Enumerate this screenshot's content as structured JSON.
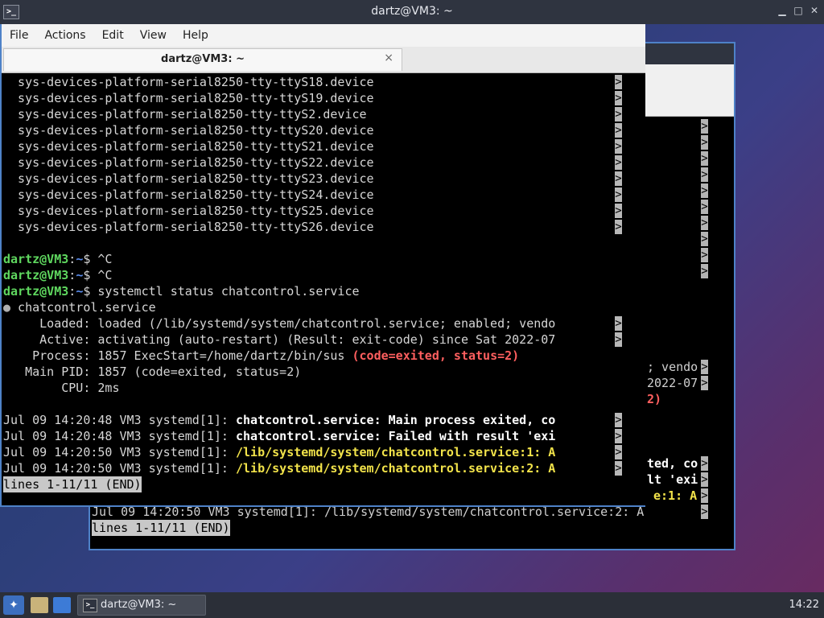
{
  "window": {
    "title": "dartz@VM3: ~"
  },
  "menu": [
    "File",
    "Actions",
    "Edit",
    "View",
    "Help"
  ],
  "tab": {
    "label": "dartz@VM3: ~",
    "close": "×"
  },
  "terminal": {
    "device_lines": [
      "  sys-devices-platform-serial8250-tty-ttyS18.device",
      "  sys-devices-platform-serial8250-tty-ttyS19.device",
      "  sys-devices-platform-serial8250-tty-ttyS2.device",
      "  sys-devices-platform-serial8250-tty-ttyS20.device",
      "  sys-devices-platform-serial8250-tty-ttyS21.device",
      "  sys-devices-platform-serial8250-tty-ttyS22.device",
      "  sys-devices-platform-serial8250-tty-ttyS23.device",
      "  sys-devices-platform-serial8250-tty-ttyS24.device",
      "  sys-devices-platform-serial8250-tty-ttyS25.device",
      "  sys-devices-platform-serial8250-tty-ttyS26.device"
    ],
    "prompt_user": "dartz@VM3",
    "prompt_sep": ":",
    "prompt_path": "~",
    "prompt_dollar": "$ ",
    "cmd1": "^C",
    "cmd2": "^C",
    "cmd3": "systemctl status chatcontrol.service",
    "bullet": "●",
    "service_name": " chatcontrol.service",
    "loaded": "     Loaded: loaded (/lib/systemd/system/chatcontrol.service; enabled; vendo",
    "active": "     Active: activating (auto-restart) (Result: exit-code) since Sat 2022-07",
    "process_prefix": "    Process: 1857 ExecStart=/home/dartz/bin/sus ",
    "process_status": "(code=exited, status=2)",
    "mainpid": "   Main PID: 1857 (code=exited, status=2)",
    "cpu": "        CPU: 2ms",
    "log_prefix_1": "Jul 09 14:20:48 VM3 systemd[1]: ",
    "log_msg_1": "chatcontrol.service: Main process exited, co",
    "log_prefix_2": "Jul 09 14:20:48 VM3 systemd[1]: ",
    "log_msg_2": "chatcontrol.service: Failed with result 'exi",
    "log_prefix_3": "Jul 09 14:20:50 VM3 systemd[1]: ",
    "log_msg_3": "/lib/systemd/system/chatcontrol.service:1: A",
    "log_prefix_4": "Jul 09 14:20:50 VM3 systemd[1]: ",
    "log_msg_4": "/lib/systemd/system/chatcontrol.service:2: A",
    "pager_status": "lines 1-11/11 (END)",
    "truncation_mark": ">"
  },
  "bg_terminal": {
    "frag_loaded": "; vendo",
    "frag_active": "2022-07",
    "frag_status": "2)",
    "frag_log1": "ted, co",
    "frag_log2": "lt 'exi",
    "frag_log3": "e:1: A",
    "log_line_4": "Jul 09 14:20:50 VM3 systemd[1]: /lib/systemd/system/chatcontrol.service:2: A",
    "pager_status": "lines 1-11/11 (END)"
  },
  "taskbar": {
    "task_label": "dartz@VM3: ~",
    "clock": "14:22"
  },
  "colors": {
    "prompt_user": "#5fd75f",
    "prompt_path": "#5c8ff0",
    "error": "#ff5f5f",
    "log_highlight": "#f2e34a",
    "window_border": "#4e82c8"
  }
}
